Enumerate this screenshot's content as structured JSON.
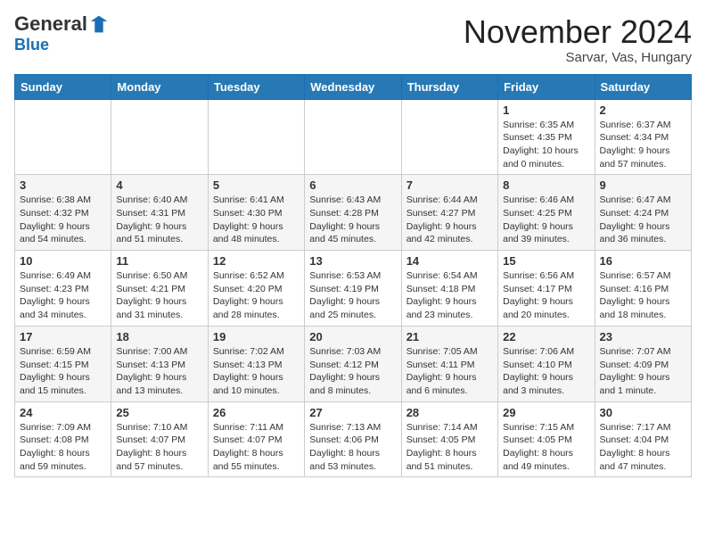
{
  "header": {
    "logo_general": "General",
    "logo_blue": "Blue",
    "month_title": "November 2024",
    "location": "Sarvar, Vas, Hungary"
  },
  "days_of_week": [
    "Sunday",
    "Monday",
    "Tuesday",
    "Wednesday",
    "Thursday",
    "Friday",
    "Saturday"
  ],
  "weeks": [
    [
      {
        "day": "",
        "info": ""
      },
      {
        "day": "",
        "info": ""
      },
      {
        "day": "",
        "info": ""
      },
      {
        "day": "",
        "info": ""
      },
      {
        "day": "",
        "info": ""
      },
      {
        "day": "1",
        "info": "Sunrise: 6:35 AM\nSunset: 4:35 PM\nDaylight: 10 hours\nand 0 minutes."
      },
      {
        "day": "2",
        "info": "Sunrise: 6:37 AM\nSunset: 4:34 PM\nDaylight: 9 hours\nand 57 minutes."
      }
    ],
    [
      {
        "day": "3",
        "info": "Sunrise: 6:38 AM\nSunset: 4:32 PM\nDaylight: 9 hours\nand 54 minutes."
      },
      {
        "day": "4",
        "info": "Sunrise: 6:40 AM\nSunset: 4:31 PM\nDaylight: 9 hours\nand 51 minutes."
      },
      {
        "day": "5",
        "info": "Sunrise: 6:41 AM\nSunset: 4:30 PM\nDaylight: 9 hours\nand 48 minutes."
      },
      {
        "day": "6",
        "info": "Sunrise: 6:43 AM\nSunset: 4:28 PM\nDaylight: 9 hours\nand 45 minutes."
      },
      {
        "day": "7",
        "info": "Sunrise: 6:44 AM\nSunset: 4:27 PM\nDaylight: 9 hours\nand 42 minutes."
      },
      {
        "day": "8",
        "info": "Sunrise: 6:46 AM\nSunset: 4:25 PM\nDaylight: 9 hours\nand 39 minutes."
      },
      {
        "day": "9",
        "info": "Sunrise: 6:47 AM\nSunset: 4:24 PM\nDaylight: 9 hours\nand 36 minutes."
      }
    ],
    [
      {
        "day": "10",
        "info": "Sunrise: 6:49 AM\nSunset: 4:23 PM\nDaylight: 9 hours\nand 34 minutes."
      },
      {
        "day": "11",
        "info": "Sunrise: 6:50 AM\nSunset: 4:21 PM\nDaylight: 9 hours\nand 31 minutes."
      },
      {
        "day": "12",
        "info": "Sunrise: 6:52 AM\nSunset: 4:20 PM\nDaylight: 9 hours\nand 28 minutes."
      },
      {
        "day": "13",
        "info": "Sunrise: 6:53 AM\nSunset: 4:19 PM\nDaylight: 9 hours\nand 25 minutes."
      },
      {
        "day": "14",
        "info": "Sunrise: 6:54 AM\nSunset: 4:18 PM\nDaylight: 9 hours\nand 23 minutes."
      },
      {
        "day": "15",
        "info": "Sunrise: 6:56 AM\nSunset: 4:17 PM\nDaylight: 9 hours\nand 20 minutes."
      },
      {
        "day": "16",
        "info": "Sunrise: 6:57 AM\nSunset: 4:16 PM\nDaylight: 9 hours\nand 18 minutes."
      }
    ],
    [
      {
        "day": "17",
        "info": "Sunrise: 6:59 AM\nSunset: 4:15 PM\nDaylight: 9 hours\nand 15 minutes."
      },
      {
        "day": "18",
        "info": "Sunrise: 7:00 AM\nSunset: 4:13 PM\nDaylight: 9 hours\nand 13 minutes."
      },
      {
        "day": "19",
        "info": "Sunrise: 7:02 AM\nSunset: 4:13 PM\nDaylight: 9 hours\nand 10 minutes."
      },
      {
        "day": "20",
        "info": "Sunrise: 7:03 AM\nSunset: 4:12 PM\nDaylight: 9 hours\nand 8 minutes."
      },
      {
        "day": "21",
        "info": "Sunrise: 7:05 AM\nSunset: 4:11 PM\nDaylight: 9 hours\nand 6 minutes."
      },
      {
        "day": "22",
        "info": "Sunrise: 7:06 AM\nSunset: 4:10 PM\nDaylight: 9 hours\nand 3 minutes."
      },
      {
        "day": "23",
        "info": "Sunrise: 7:07 AM\nSunset: 4:09 PM\nDaylight: 9 hours\nand 1 minute."
      }
    ],
    [
      {
        "day": "24",
        "info": "Sunrise: 7:09 AM\nSunset: 4:08 PM\nDaylight: 8 hours\nand 59 minutes."
      },
      {
        "day": "25",
        "info": "Sunrise: 7:10 AM\nSunset: 4:07 PM\nDaylight: 8 hours\nand 57 minutes."
      },
      {
        "day": "26",
        "info": "Sunrise: 7:11 AM\nSunset: 4:07 PM\nDaylight: 8 hours\nand 55 minutes."
      },
      {
        "day": "27",
        "info": "Sunrise: 7:13 AM\nSunset: 4:06 PM\nDaylight: 8 hours\nand 53 minutes."
      },
      {
        "day": "28",
        "info": "Sunrise: 7:14 AM\nSunset: 4:05 PM\nDaylight: 8 hours\nand 51 minutes."
      },
      {
        "day": "29",
        "info": "Sunrise: 7:15 AM\nSunset: 4:05 PM\nDaylight: 8 hours\nand 49 minutes."
      },
      {
        "day": "30",
        "info": "Sunrise: 7:17 AM\nSunset: 4:04 PM\nDaylight: 8 hours\nand 47 minutes."
      }
    ]
  ]
}
